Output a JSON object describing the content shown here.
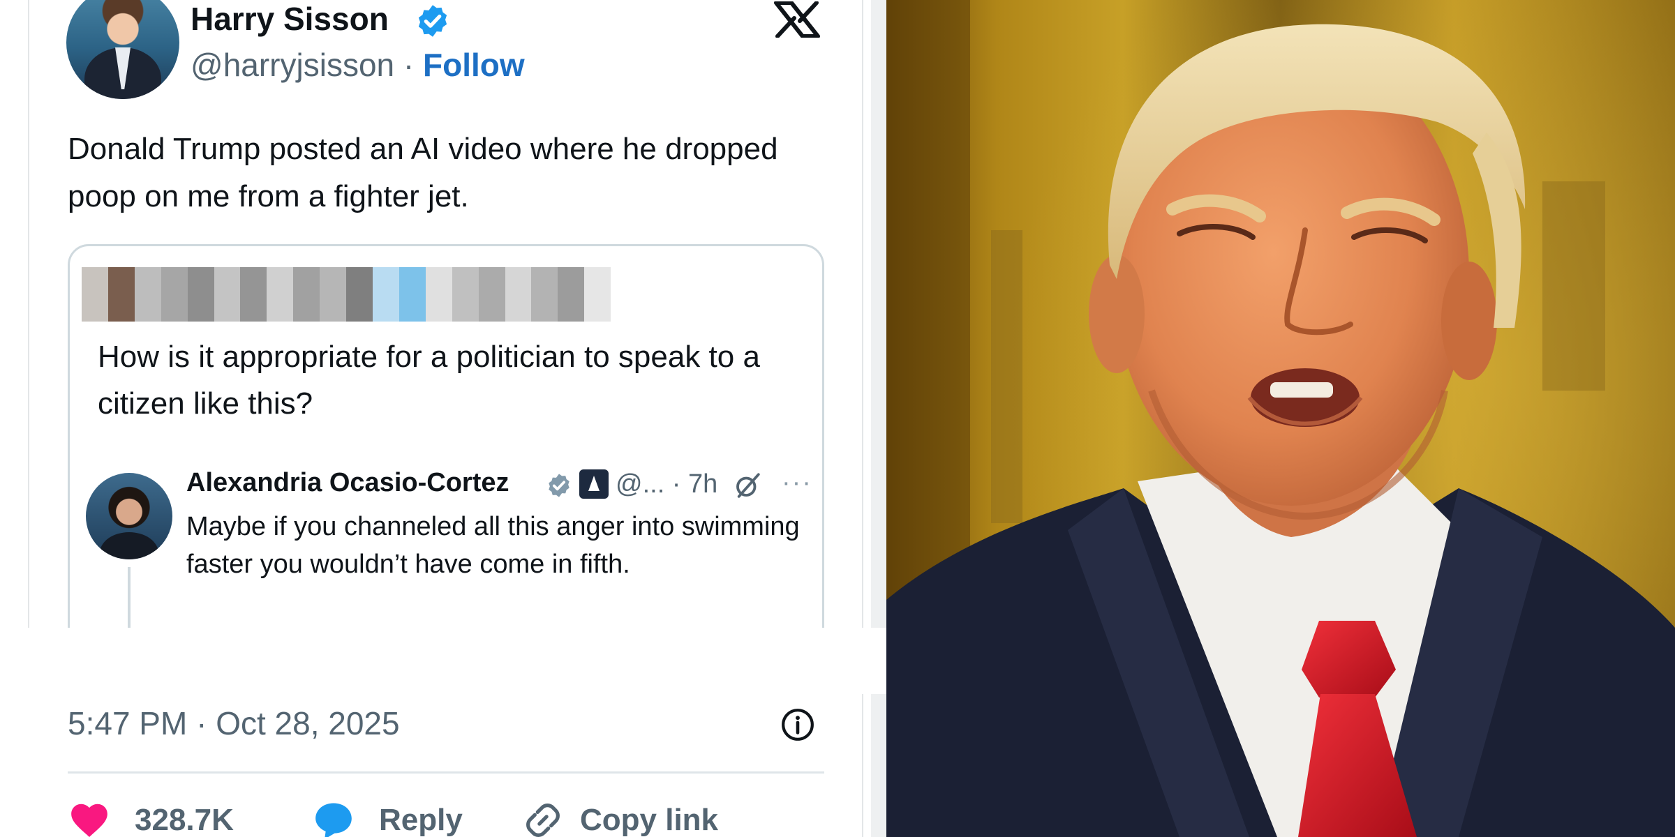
{
  "tweet": {
    "author_name": "Harry Sisson",
    "handle": "@harryjsisson",
    "separator": " · ",
    "follow_label": "Follow",
    "text": "Donald Trump posted an AI video where he dropped poop on me from a fighter jet.",
    "quoted": {
      "text": "How is it appropriate for a politician to speak to a citizen like this?",
      "reply": {
        "author_name": "Alexandria Ocasio-Cortez",
        "meta": "@... · 7h",
        "more_label": "···",
        "text": "Maybe if you channeled all this anger into swimming faster you wouldn’t have come in fifth."
      }
    },
    "timestamp": "5:47 PM · Oct 28, 2025",
    "actions": {
      "like_count": "328.7K",
      "reply_label": "Reply",
      "copy_label": "Copy link"
    }
  },
  "icons": {
    "verified": "verified-badge-icon",
    "platform": "x-logo-icon",
    "government": "government-badge-icon",
    "grok": "grok-icon",
    "info": "info-icon",
    "like": "heart-icon",
    "reply": "speech-bubble-icon",
    "copy": "link-icon"
  },
  "colors": {
    "brand_blue": "#1d9bf0",
    "follow_blue": "#1d6fc4",
    "like_pink": "#f91880",
    "text_primary": "#0f1419",
    "text_secondary": "#536471",
    "tie_red": "#d3101c",
    "suit_navy": "#1b2034"
  }
}
